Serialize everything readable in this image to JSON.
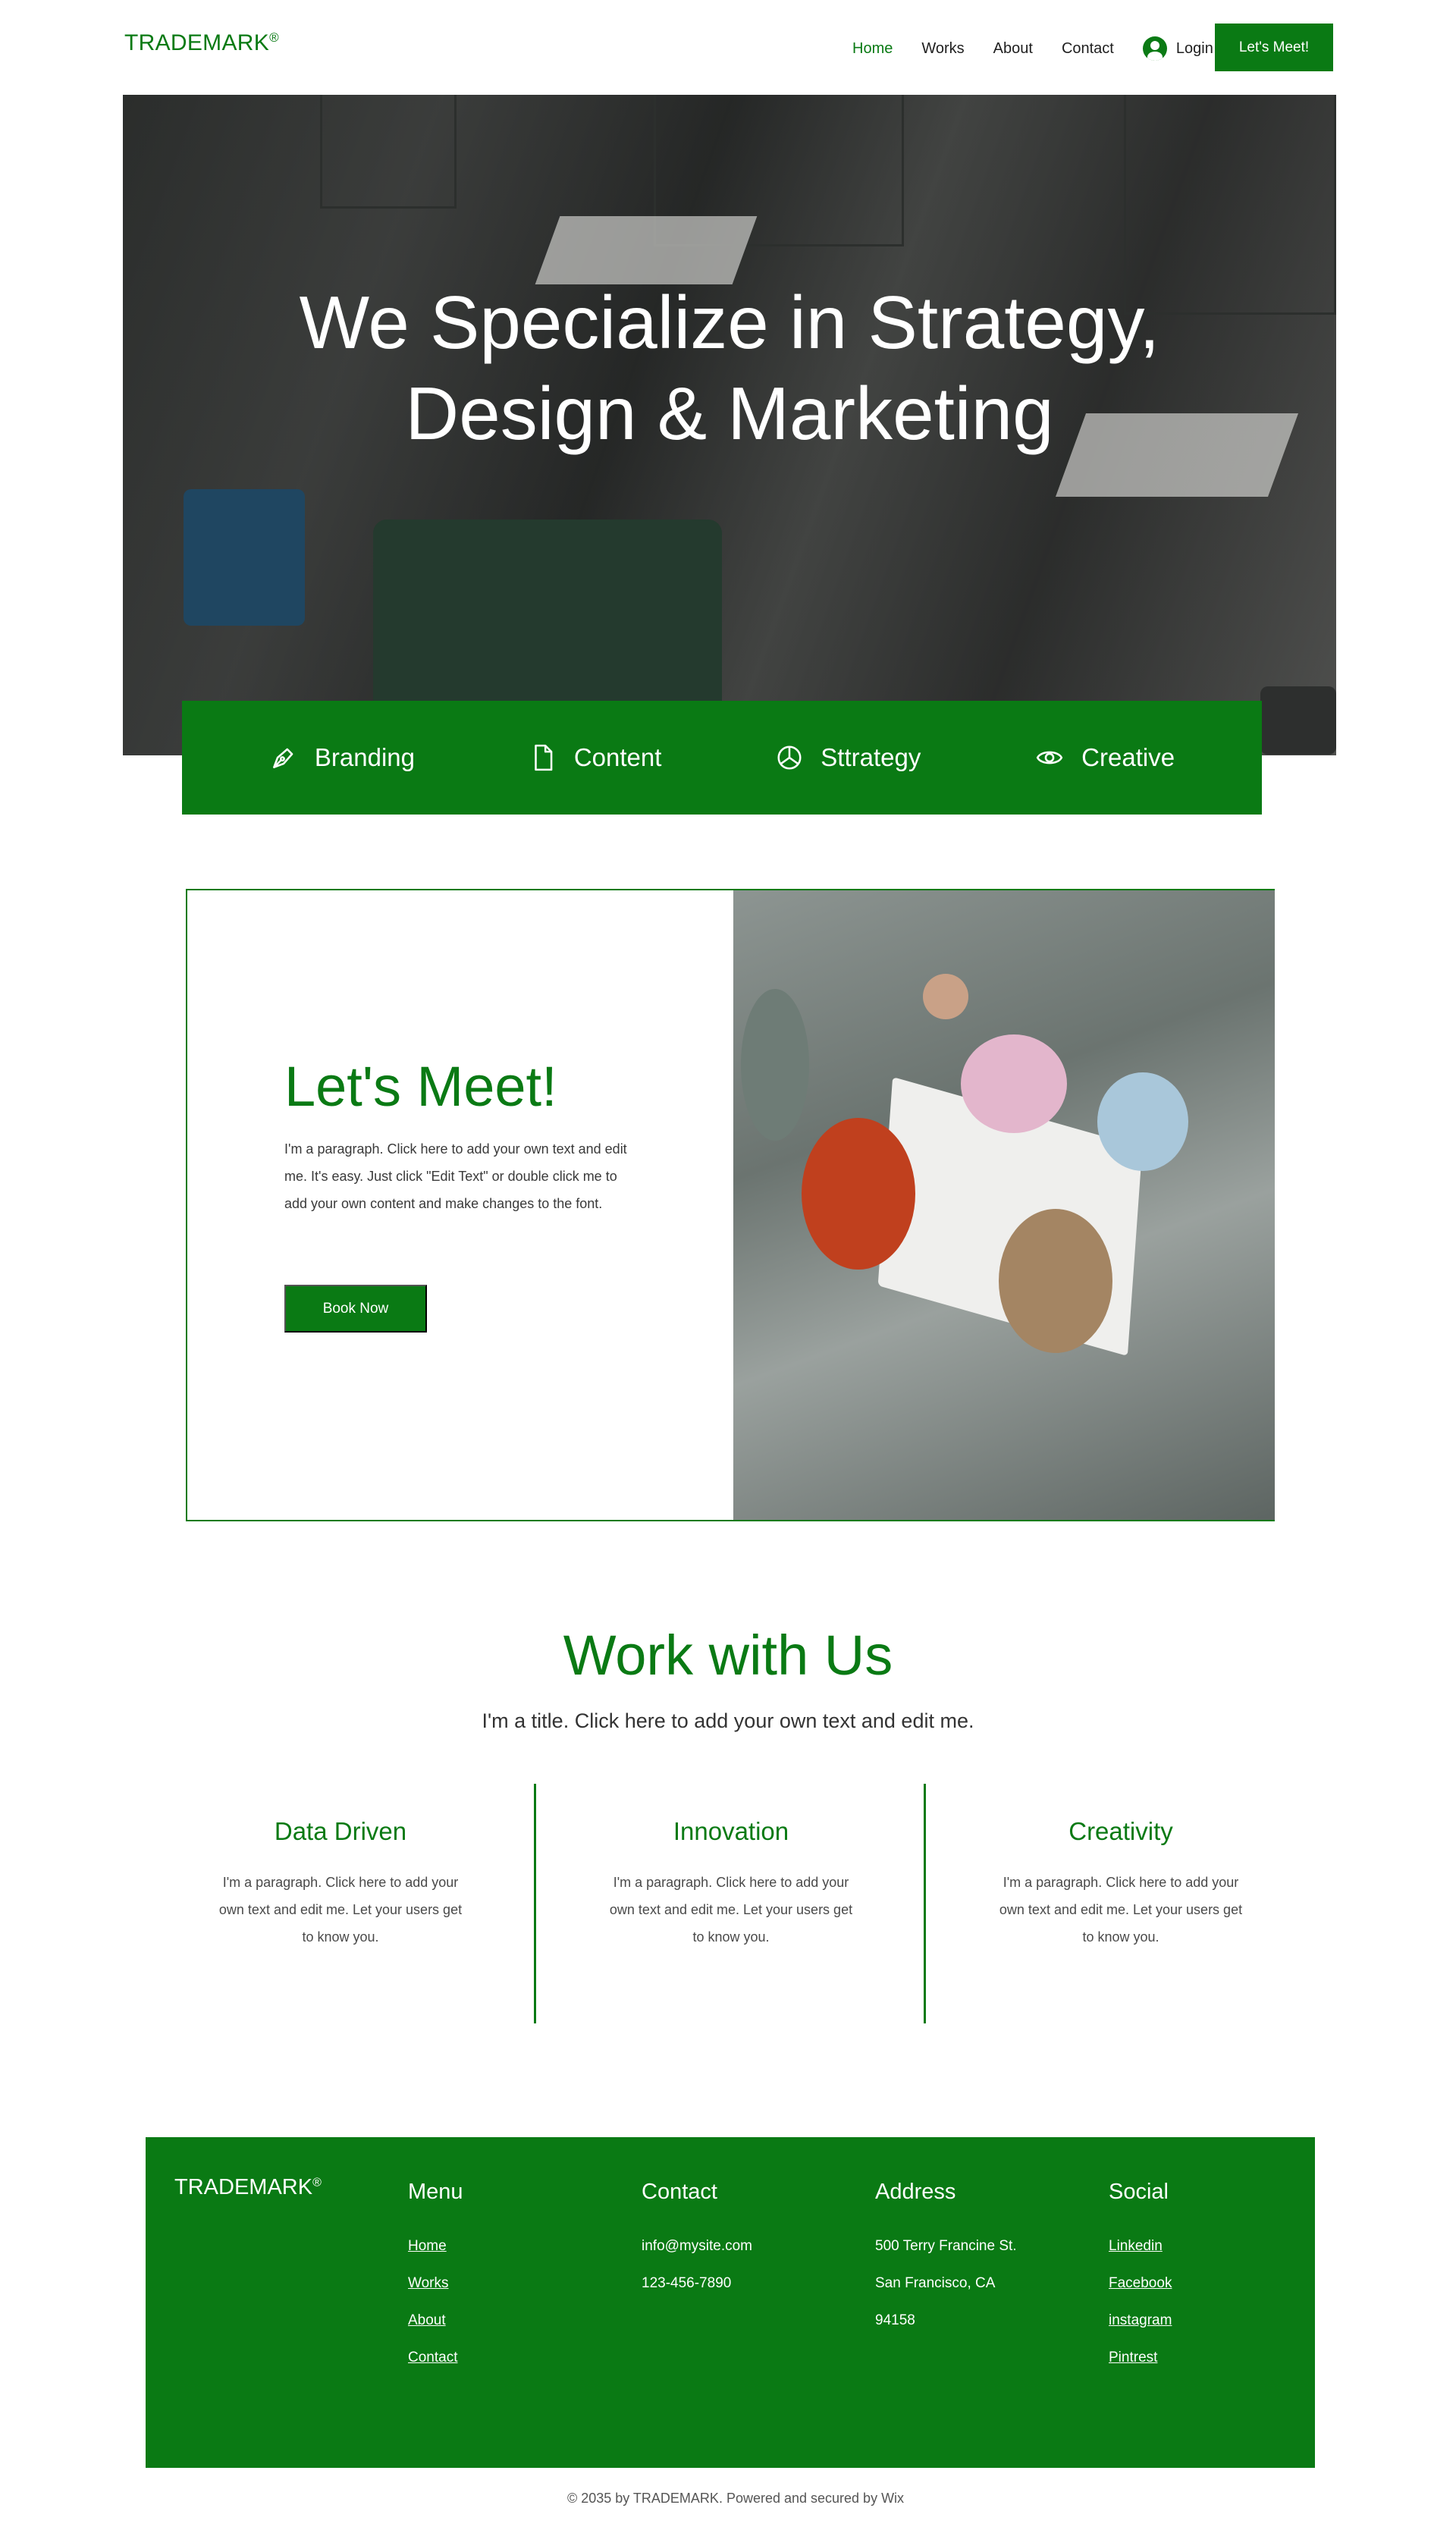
{
  "header": {
    "logo": "TRADEMARK",
    "logo_mark": "®",
    "nav": [
      {
        "label": "Home",
        "active": true
      },
      {
        "label": "Works",
        "active": false
      },
      {
        "label": "About",
        "active": false
      },
      {
        "label": "Contact",
        "active": false
      }
    ],
    "login_label": "Login",
    "login_icon": "user-circle-icon",
    "cta_label": "Let's Meet!"
  },
  "hero": {
    "title_line1": "We Specialize in Strategy,",
    "title_line2": "Design & Marketing"
  },
  "services": [
    {
      "label": "Branding",
      "icon": "pen-nib-icon"
    },
    {
      "label": "Content",
      "icon": "document-icon"
    },
    {
      "label": "Sttrategy",
      "icon": "pie-chart-icon"
    },
    {
      "label": "Creative",
      "icon": "eye-icon"
    }
  ],
  "meet": {
    "title": "Let's Meet!",
    "paragraph": "I'm a paragraph. Click here to add your own text and edit me. It's easy. Just click \"Edit Text\" or double click me to add your own content and make changes to the font.",
    "button_label": "Book Now"
  },
  "work": {
    "title": "Work with Us",
    "subtitle": "I'm a title. Click here to add your own text and edit me.",
    "columns": [
      {
        "title": "Data Driven",
        "text": "I'm a paragraph. Click here to add your own text and edit me. Let your users get to know you."
      },
      {
        "title": "Innovation",
        "text": "I'm a paragraph. Click here to add your own text and edit me. Let your users get to know you."
      },
      {
        "title": "Creativity",
        "text": "I'm a paragraph. Click here to add your own text and edit me. Let your users get to know you."
      }
    ]
  },
  "footer": {
    "logo": "TRADEMARK",
    "logo_mark": "®",
    "menu": {
      "title": "Menu",
      "items": [
        "Home",
        "Works",
        "About",
        "Contact"
      ]
    },
    "contact": {
      "title": "Contact",
      "items": [
        "info@mysite.com",
        "123-456-7890"
      ]
    },
    "address": {
      "title": "Address",
      "items": [
        "500 Terry Francine St.",
        "San Francisco, CA",
        "94158"
      ]
    },
    "social": {
      "title": "Social",
      "items": [
        "Linkedin",
        "Facebook",
        "instagram",
        "Pintrest"
      ]
    },
    "copyright": "© 2035 by TRADEMARK. Powered and secured by Wix"
  },
  "colors": {
    "accent": "#0a7a14",
    "text": "#1f1f1f",
    "background": "#ffffff"
  }
}
